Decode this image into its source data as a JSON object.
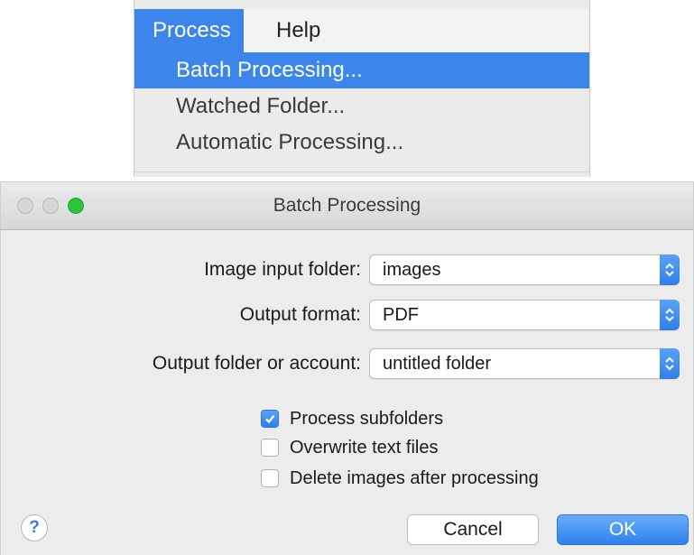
{
  "menu": {
    "bar": [
      "Process",
      "Help"
    ],
    "items": [
      "Batch Processing...",
      "Watched Folder...",
      "Automatic Processing..."
    ],
    "highlighted_index": 0
  },
  "window": {
    "title": "Batch Processing"
  },
  "form": {
    "input_folder_label": "Image input folder:",
    "input_folder_value": "images",
    "output_format_label": "Output format:",
    "output_format_value": "PDF",
    "output_folder_label": "Output folder or account:",
    "output_folder_value": "untitled folder"
  },
  "options": [
    {
      "label": "Process subfolders",
      "checked": true
    },
    {
      "label": "Overwrite text files",
      "checked": false
    },
    {
      "label": "Delete images after processing",
      "checked": false
    }
  ],
  "buttons": {
    "help": "?",
    "cancel": "Cancel",
    "ok": "OK"
  },
  "colors": {
    "accent": "#3c85eb",
    "zoom_green": "#2dc43d"
  }
}
